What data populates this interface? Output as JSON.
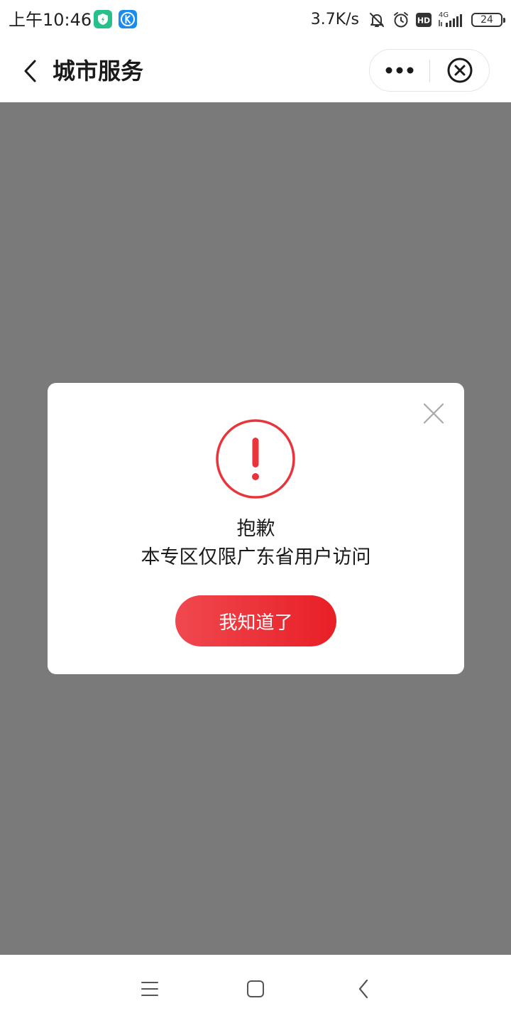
{
  "status_bar": {
    "time": "上午10:46",
    "network_speed": "3.7K/s",
    "network_type": "4G",
    "hd_label": "HD",
    "battery_level": "24",
    "icons": [
      "shield-app-icon",
      "k-app-icon",
      "mute-bell-icon",
      "alarm-icon",
      "hd-icon",
      "signal-icon",
      "battery-icon"
    ]
  },
  "nav": {
    "title": "城市服务",
    "icons": [
      "back-arrow-icon",
      "more-dots-icon",
      "close-circle-icon"
    ]
  },
  "dialog": {
    "title": "抱歉",
    "message": "本专区仅限广东省用户访问",
    "confirm_label": "我知道了",
    "icons": [
      "close-x-icon",
      "warning-exclamation-icon"
    ],
    "accent_color": "#e8343a"
  },
  "system_nav": {
    "icons": [
      "menu-lines-icon",
      "home-square-icon",
      "back-chevron-icon"
    ]
  },
  "colors": {
    "overlay": "#7a7a7a",
    "button_gradient_start": "#f0484f",
    "button_gradient_end": "#e81f26"
  }
}
